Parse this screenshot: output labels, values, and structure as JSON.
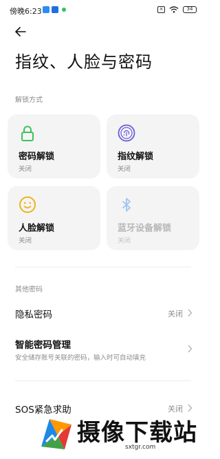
{
  "status_bar": {
    "time": "傍晚6:23",
    "battery": "34"
  },
  "header": {
    "title": "指纹、人脸与密码"
  },
  "unlock_section": {
    "label": "解锁方式",
    "cards": [
      {
        "title": "密码解锁",
        "status": "关闭",
        "icon": "lock-icon",
        "color": "#3cc25a"
      },
      {
        "title": "指纹解锁",
        "status": "关闭",
        "icon": "fingerprint-icon",
        "color": "#6a5cd6"
      },
      {
        "title": "人脸解锁",
        "status": "关闭",
        "icon": "face-icon",
        "color": "#f0b21c"
      },
      {
        "title": "蓝牙设备解锁",
        "status": "关闭",
        "icon": "bluetooth-icon",
        "color": "#9cc6ee"
      }
    ]
  },
  "other_section": {
    "label": "其他密码",
    "items": [
      {
        "title": "隐私密码",
        "value": "关闭"
      },
      {
        "title": "智能密码管理",
        "subtitle": "安全储存账号关联的密码，输入时可自动填充"
      },
      {
        "title": "SOS紧急求助",
        "value": "关闭"
      }
    ]
  },
  "watermark": {
    "text": "摄像下载站",
    "url": "sxtgr.com"
  }
}
